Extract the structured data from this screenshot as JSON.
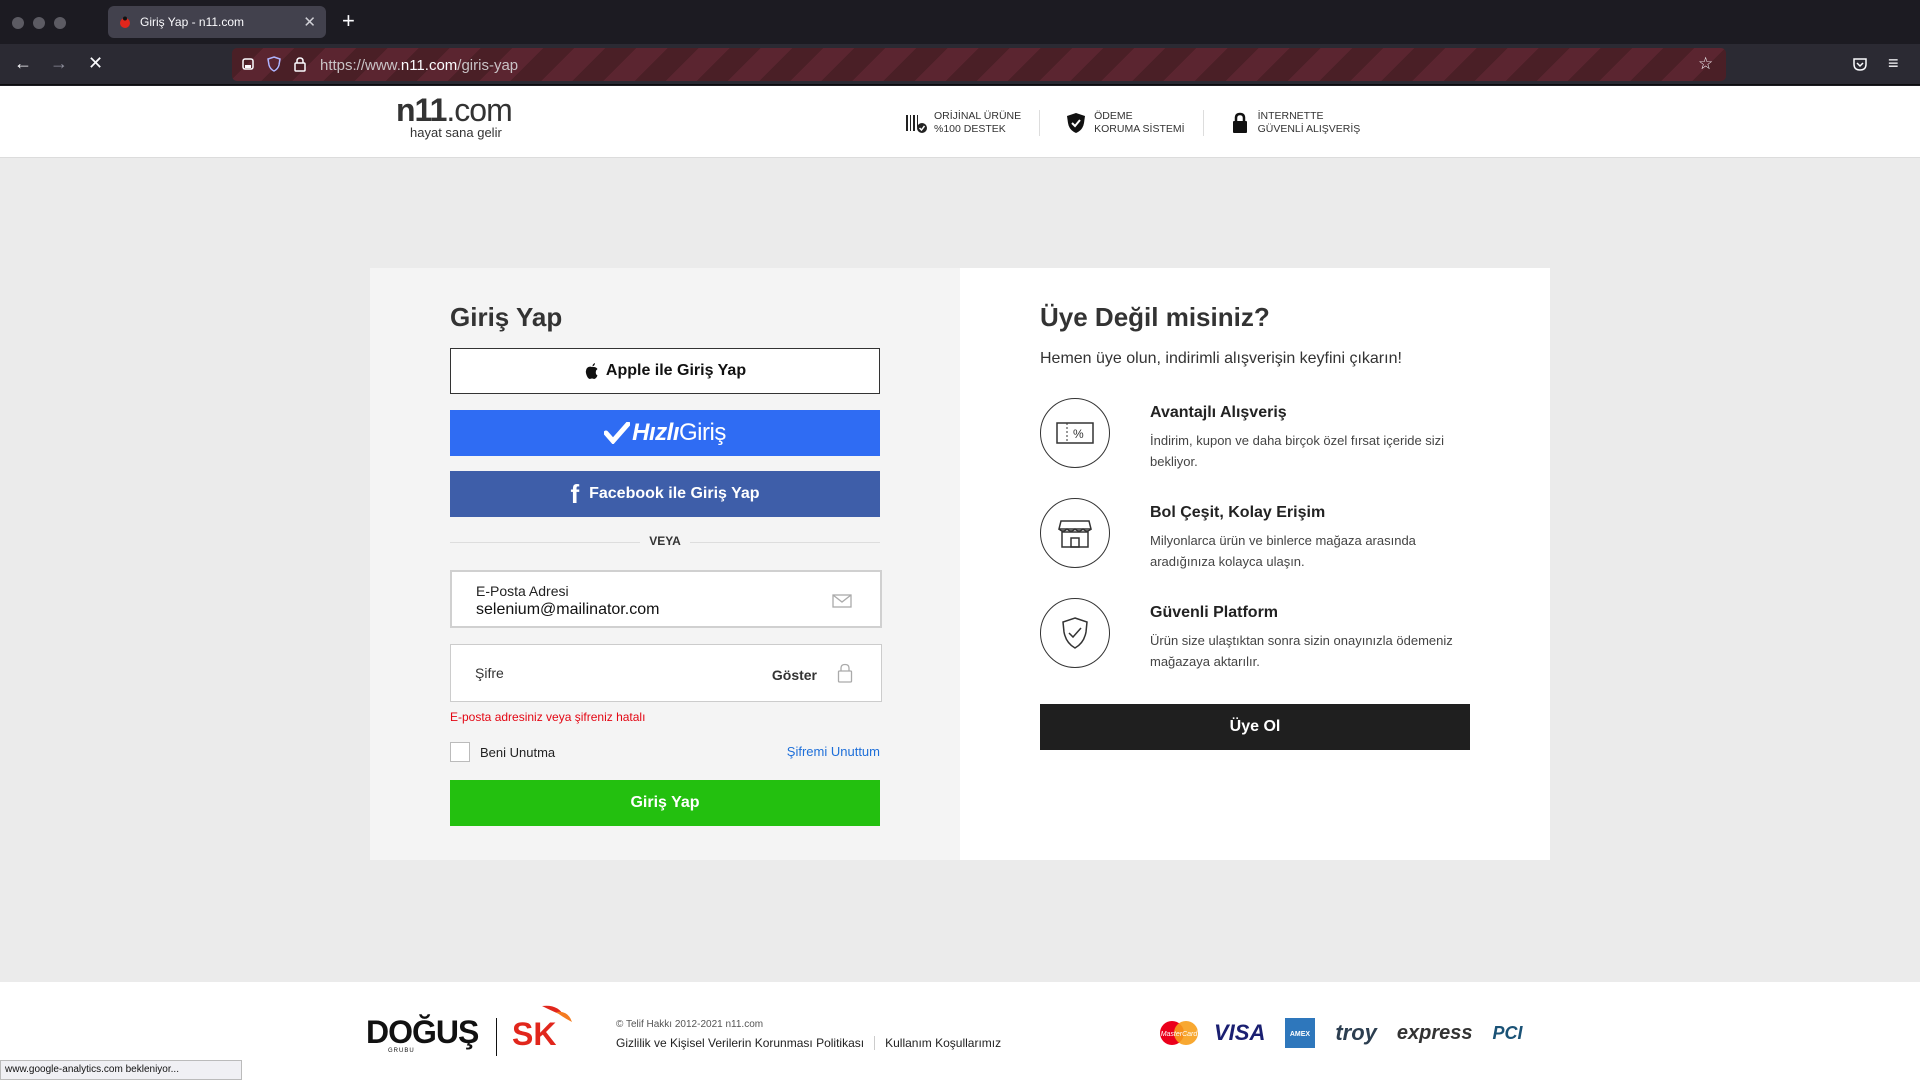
{
  "browser": {
    "tab_title": "Giriş Yap - n11.com",
    "new_tab_symbol": "+",
    "url_prefix": "https://www.",
    "url_host": "n11.com",
    "url_path": "/giris-yap",
    "status_text": "www.google-analytics.com bekleniyor..."
  },
  "header": {
    "logo_text": "n11",
    "logo_com": ".com",
    "logo_tagline": "hayat sana gelir",
    "badges": [
      {
        "line1": "ORİJİNAL ÜRÜNE",
        "line2": "%100 DESTEK",
        "icon": "barcode-check-icon"
      },
      {
        "line1": "ÖDEME",
        "line2": "KORUMA SİSTEMİ",
        "icon": "shield-check-icon"
      },
      {
        "line1": "İNTERNETTE",
        "line2": "GÜVENLİ ALIŞVERİŞ",
        "icon": "padlock-icon"
      }
    ]
  },
  "login": {
    "title": "Giriş Yap",
    "apple_label": "Apple ile Giriş Yap",
    "hizli_bold": "Hızlı",
    "hizli_light": "Giriş",
    "facebook_label": "Facebook ile Giriş Yap",
    "divider_text": "VEYA",
    "email_label": "E-Posta Adresi",
    "email_value": "selenium@mailinator.com",
    "password_label": "Şifre",
    "show_label": "Göster",
    "error_text": "E-posta adresiniz veya şifreniz hatalı",
    "remember_label": "Beni Unutma",
    "forgot_label": "Şifremi Unuttum",
    "submit_label": "Giriş Yap"
  },
  "register": {
    "title": "Üye Değil misiniz?",
    "lead": "Hemen üye olun, indirimli alışverişin keyfini çıkarın!",
    "features": [
      {
        "title": "Avantajlı Alışveriş",
        "desc": "İndirim, kupon ve daha birçok özel fırsat içeride sizi bekliyor."
      },
      {
        "title": "Bol Çeşit, Kolay Erişim",
        "desc": "Milyonlarca ürün ve binlerce mağaza arasında aradığınıza kolayca ulaşın."
      },
      {
        "title": "Güvenli Platform",
        "desc": "Ürün size ulaştıktan sonra sizin onayınızla ödemeniz mağazaya aktarılır."
      }
    ],
    "button_label": "Üye Ol"
  },
  "footer": {
    "dogus": "DOĞUŞ",
    "dogus_sub": "GRUBU",
    "sk": "SK",
    "copyright": "© Telif Hakkı 2012-2021 n11.com",
    "privacy": "Gizlilik ve Kişisel Verilerin Korunması Politikası",
    "terms": "Kullanım Koşullarımız",
    "payments": [
      "MasterCard",
      "VISA",
      "AMEX",
      "troy",
      "express",
      "PCI"
    ]
  },
  "colors": {
    "hizli_blue": "#2f6cf3",
    "facebook_blue": "#3e5ea9",
    "login_green": "#23c00f",
    "error_red": "#e30613",
    "link_blue": "#1e6fd9"
  }
}
